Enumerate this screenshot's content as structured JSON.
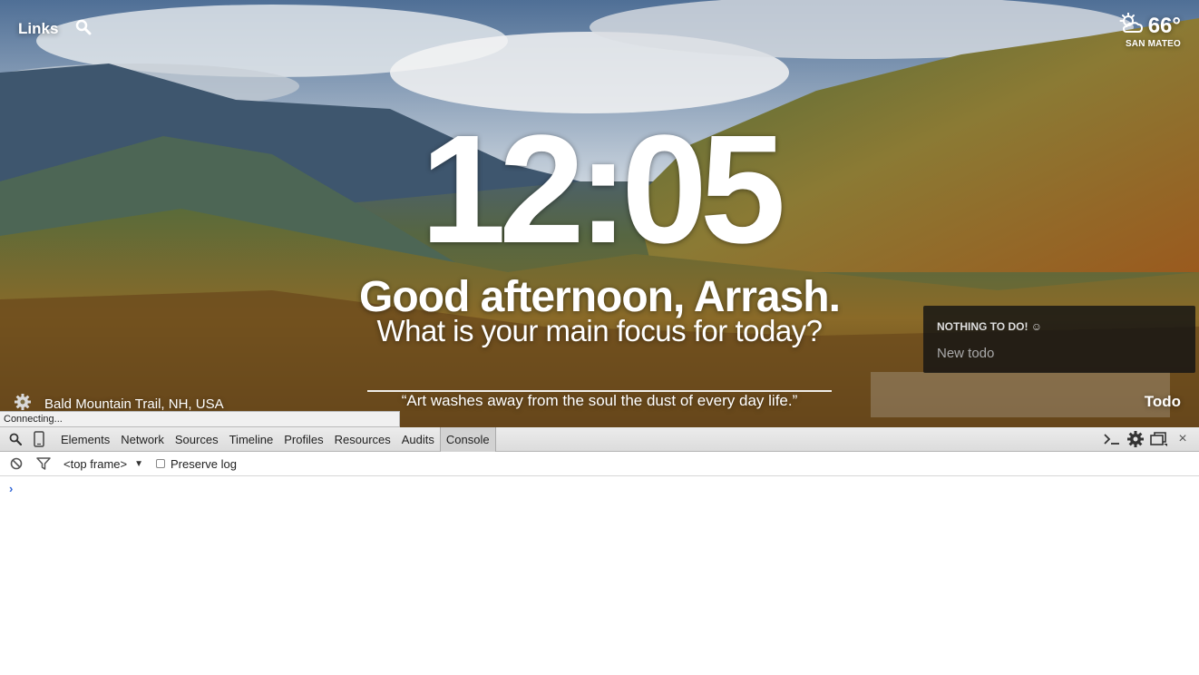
{
  "header": {
    "links_label": "Links",
    "search_icon": "search-icon"
  },
  "weather": {
    "icon": "partly-cloudy-icon",
    "temperature": "66°",
    "location": "SAN MATEO"
  },
  "center": {
    "time": "12:05",
    "greeting": "Good afternoon, Arrash.",
    "focus_question": "What is your main focus for today?",
    "quote": "“Art washes away from the soul the dust of every day life.”"
  },
  "footer": {
    "settings_icon": "gear-icon",
    "photo_location": "Bald Mountain Trail, NH, USA",
    "todo_label": "Todo"
  },
  "todo_panel": {
    "empty_message": "NOTHING TO DO! ☺",
    "new_todo_placeholder": "New todo"
  },
  "status_bubble": "Connecting...",
  "devtools": {
    "tabs": [
      "Elements",
      "Network",
      "Sources",
      "Timeline",
      "Profiles",
      "Resources",
      "Audits",
      "Console"
    ],
    "active_tab": "Console",
    "frame_select": "<top frame>",
    "preserve_log_label": "Preserve log",
    "prompt_glyph": "›",
    "close_glyph": "×"
  },
  "colors": {
    "prompt_blue": "#3367d6",
    "todo_panel_bg": "#141414"
  }
}
